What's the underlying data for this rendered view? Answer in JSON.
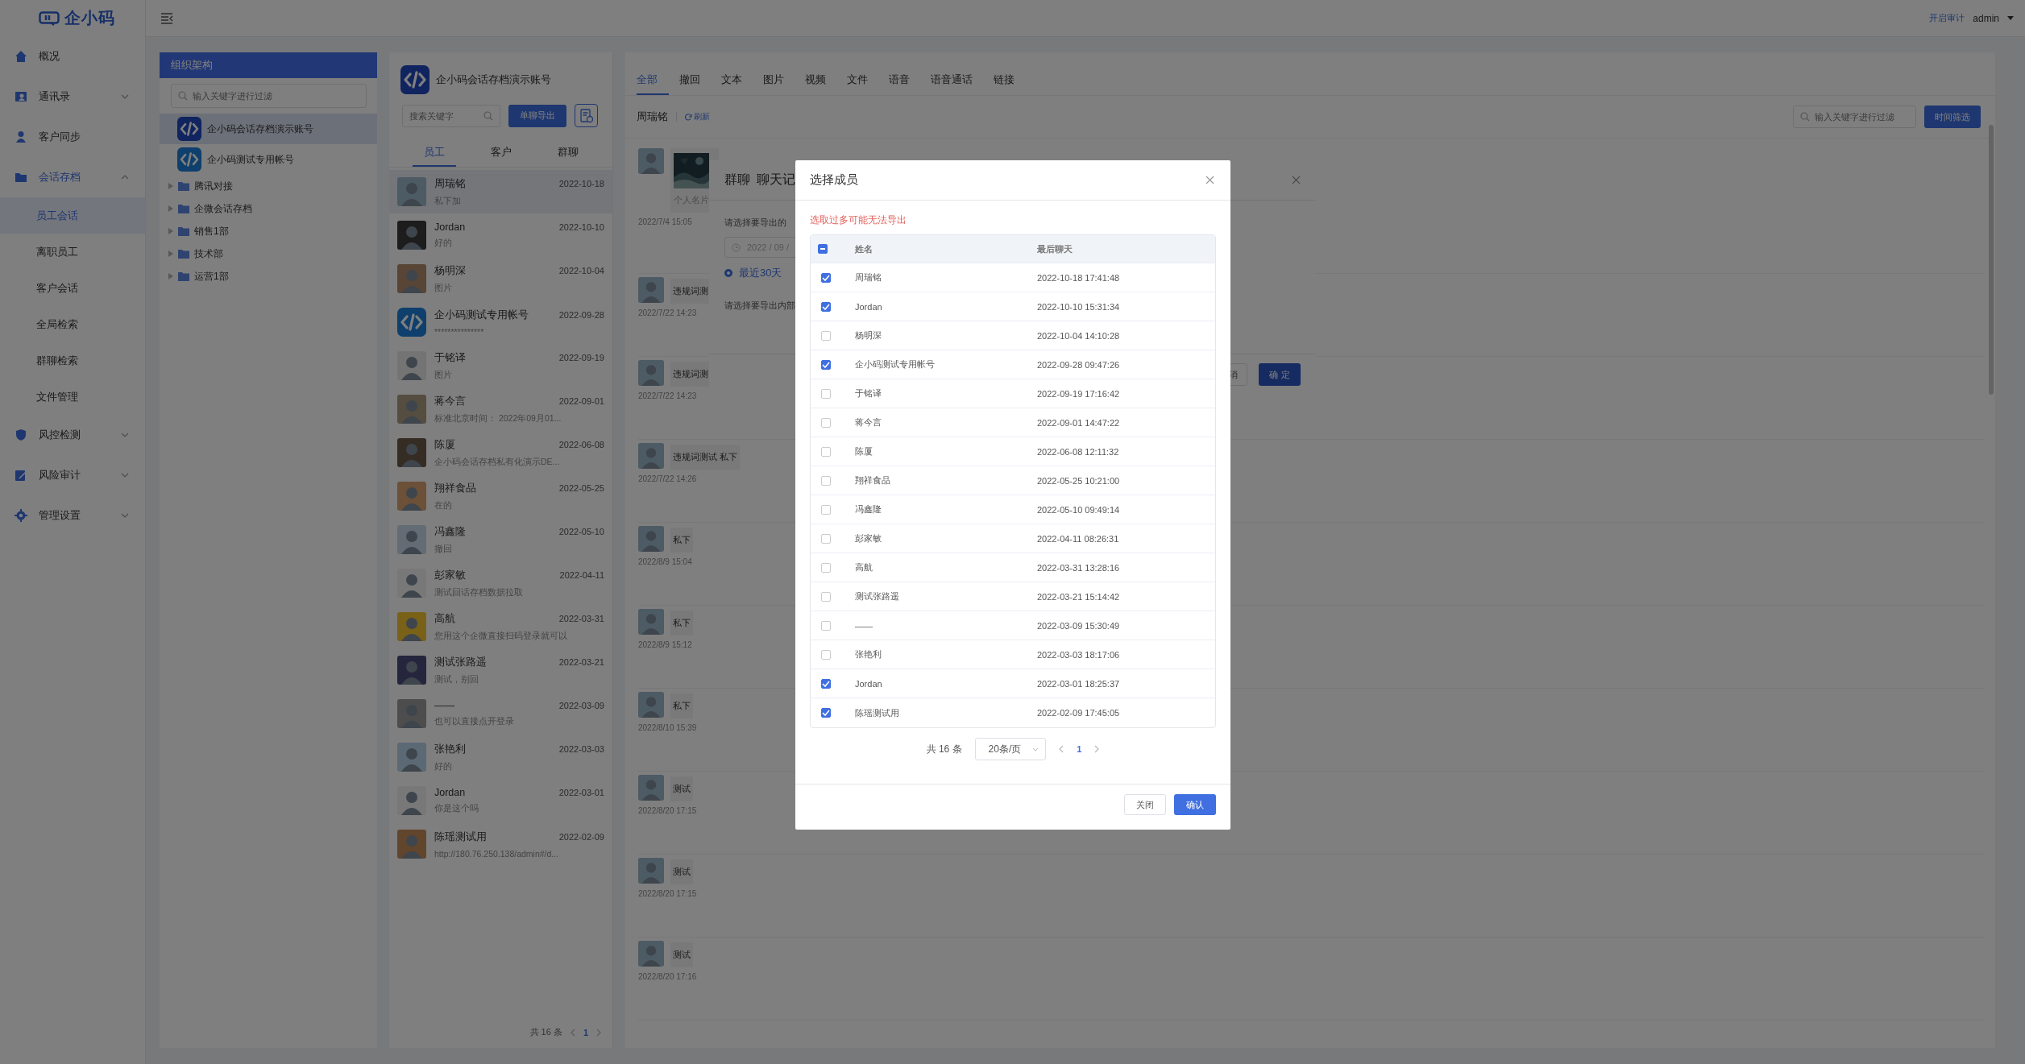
{
  "logo": {
    "text": "企小码"
  },
  "sidebar": {
    "items": [
      {
        "label": "概况",
        "kind": "link",
        "selected": false
      },
      {
        "label": "通讯录",
        "kind": "menu",
        "selected": false,
        "expanded": false
      },
      {
        "label": "客户同步",
        "kind": "link",
        "selected": false
      },
      {
        "label": "会话存档",
        "kind": "menu",
        "selected": true,
        "expanded": true,
        "children": [
          {
            "label": "员工会话",
            "selected": true
          },
          {
            "label": "离职员工",
            "selected": false
          },
          {
            "label": "客户会话",
            "selected": false
          },
          {
            "label": "全局检索",
            "selected": false
          },
          {
            "label": "群聊检索",
            "selected": false
          },
          {
            "label": "文件管理",
            "selected": false
          }
        ]
      },
      {
        "label": "风控检测",
        "kind": "menu",
        "selected": false,
        "expanded": false
      },
      {
        "label": "风险审计",
        "kind": "menu",
        "selected": false,
        "expanded": false
      },
      {
        "label": "管理设置",
        "kind": "menu",
        "selected": false,
        "expanded": false
      }
    ]
  },
  "topbar": {
    "audit_link": "开启审计",
    "user": "admin"
  },
  "org_panel": {
    "title": "组织架构",
    "search": {
      "placeholder": "输入关键字进行过滤"
    },
    "tree": [
      {
        "label": "企小码会话存档演示账号",
        "kind": "account",
        "selected": true
      },
      {
        "label": "企小码测试专用帐号",
        "kind": "account",
        "selected": false
      },
      {
        "label": "腾讯对接",
        "kind": "folder",
        "selected": false,
        "expanded": false
      },
      {
        "label": "企微会话存档",
        "kind": "folder",
        "selected": false,
        "expanded": false
      },
      {
        "label": "销售1部",
        "kind": "folder",
        "selected": false,
        "expanded": false
      },
      {
        "label": "技术部",
        "kind": "folder",
        "selected": false,
        "expanded": false
      },
      {
        "label": "运营1部",
        "kind": "folder",
        "selected": false,
        "expanded": false
      }
    ]
  },
  "conversation_panel": {
    "account": "企小码会话存档演示账号",
    "search": {
      "placeholder": "搜索关键字"
    },
    "export_button": "单聊导出",
    "tabs": [
      {
        "label": "员工",
        "selected": true
      },
      {
        "label": "客户",
        "selected": false
      },
      {
        "label": "群聊",
        "selected": false
      }
    ],
    "conversations": [
      {
        "name": "周瑞铭",
        "date": "2022-10-18",
        "preview": "私下加",
        "kind": "person",
        "selected": true
      },
      {
        "name": "Jordan",
        "date": "2022-10-10",
        "preview": "好的",
        "kind": "person",
        "selected": false
      },
      {
        "name": "杨明深",
        "date": "2022-10-04",
        "preview": "图片",
        "kind": "person",
        "selected": false
      },
      {
        "name": "企小码测试专用帐号",
        "date": "2022-09-28",
        "preview": "***************",
        "kind": "logo",
        "selected": false
      },
      {
        "name": "于铭译",
        "date": "2022-09-19",
        "preview": "图片",
        "kind": "person",
        "selected": false
      },
      {
        "name": "蒋今言",
        "date": "2022-09-01",
        "preview": "标准北京时间： 2022年09月01...",
        "kind": "person",
        "selected": false
      },
      {
        "name": "陈厦",
        "date": "2022-06-08",
        "preview": "企小码会话存档私有化演示DE...",
        "kind": "person",
        "selected": false
      },
      {
        "name": "翔祥食品",
        "date": "2022-05-25",
        "preview": "在的",
        "kind": "person",
        "selected": false
      },
      {
        "name": "冯鑫隆",
        "date": "2022-05-10",
        "preview": "撤回",
        "kind": "person",
        "selected": false
      },
      {
        "name": "彭家敏",
        "date": "2022-04-11",
        "preview": "测试回话存档数据拉取",
        "kind": "person",
        "selected": false
      },
      {
        "name": "高航",
        "date": "2022-03-31",
        "preview": "您用这个企微直接扫码登录就可以",
        "kind": "person",
        "selected": false
      },
      {
        "name": "测试张路遥",
        "date": "2022-03-21",
        "preview": "测试，别回",
        "kind": "person",
        "selected": false
      },
      {
        "name": "——",
        "date": "2022-03-09",
        "preview": "也可以直接点开登录",
        "kind": "person",
        "selected": false
      },
      {
        "name": "张艳利",
        "date": "2022-03-03",
        "preview": "好的",
        "kind": "person",
        "selected": false
      },
      {
        "name": "Jordan",
        "date": "2022-03-01",
        "preview": "你是这个吗",
        "kind": "person",
        "selected": false
      },
      {
        "name": "陈瑶测试用",
        "date": "2022-02-09",
        "preview": "http://180.76.250.138/admin#/d...",
        "kind": "person",
        "selected": false
      }
    ],
    "pagination": {
      "total": "共 16 条",
      "page": "1"
    }
  },
  "chat": {
    "filters": [
      {
        "label": "全部",
        "selected": true
      },
      {
        "label": "撤回",
        "selected": false
      },
      {
        "label": "文本",
        "selected": false
      },
      {
        "label": "图片",
        "selected": false
      },
      {
        "label": "视频",
        "selected": false
      },
      {
        "label": "文件",
        "selected": false
      },
      {
        "label": "语音",
        "selected": false
      },
      {
        "label": "语音通话",
        "selected": false
      },
      {
        "label": "链接",
        "selected": false
      }
    ],
    "contact": "周瑞铭",
    "refresh": "刷新",
    "search": {
      "placeholder": "输入关键字进行过滤"
    },
    "time_filter_button": "时间筛选",
    "messages": [
      {
        "kind": "card",
        "text": "个人名片",
        "time": "2022/7/4 15:05"
      },
      {
        "kind": "text",
        "text": "违规词测",
        "time": "2022/7/22 14:23"
      },
      {
        "kind": "text",
        "text": "违规词测",
        "time": "2022/7/22 14:23"
      },
      {
        "kind": "text",
        "text": "违规词测试 私下",
        "time": "2022/7/22 14:26"
      },
      {
        "kind": "text",
        "text": "私下",
        "time": "2022/8/9 15:04"
      },
      {
        "kind": "text",
        "text": "私下",
        "time": "2022/8/9 15:12"
      },
      {
        "kind": "text",
        "text": "私下",
        "time": "2022/8/10 15:39"
      },
      {
        "kind": "text",
        "text": "测试",
        "time": "2022/8/20 17:15"
      },
      {
        "kind": "text",
        "text": "测试",
        "time": "2022/8/20 17:15"
      },
      {
        "kind": "text",
        "text": "测试",
        "time": "2022/8/20 17:16"
      }
    ]
  },
  "export_dialog": {
    "tag": "群聊",
    "title": "聊天记",
    "date_prompt": "请选择要导出的",
    "date_value": "2022 / 09 /",
    "range_option": {
      "label": "最近30天",
      "selected": true
    },
    "member_prompt": "请选择要导出内部",
    "cancel_button": "消",
    "confirm_button": "确 定"
  },
  "member_dialog": {
    "title": "选择成员",
    "warning": "选取过多可能无法导出",
    "select_all": {
      "indeterminate": true
    },
    "columns": [
      "姓名",
      "最后聊天"
    ],
    "rows": [
      {
        "name": "周瑞铭",
        "last_chat": "2022-10-18 17:41:48",
        "checked": true
      },
      {
        "name": "Jordan",
        "last_chat": "2022-10-10 15:31:34",
        "checked": true
      },
      {
        "name": "杨明深",
        "last_chat": "2022-10-04 14:10:28",
        "checked": false
      },
      {
        "name": "企小码测试专用帐号",
        "last_chat": "2022-09-28 09:47:26",
        "checked": true
      },
      {
        "name": "于铭译",
        "last_chat": "2022-09-19 17:16:42",
        "checked": false
      },
      {
        "name": "蒋今言",
        "last_chat": "2022-09-01 14:47:22",
        "checked": false
      },
      {
        "name": "陈厦",
        "last_chat": "2022-06-08 12:11:32",
        "checked": false
      },
      {
        "name": "翔祥食品",
        "last_chat": "2022-05-25 10:21:00",
        "checked": false
      },
      {
        "name": "冯鑫隆",
        "last_chat": "2022-05-10 09:49:14",
        "checked": false
      },
      {
        "name": "彭家敏",
        "last_chat": "2022-04-11 08:26:31",
        "checked": false
      },
      {
        "name": "高航",
        "last_chat": "2022-03-31 13:28:16",
        "checked": false
      },
      {
        "name": "测试张路遥",
        "last_chat": "2022-03-21 15:14:42",
        "checked": false
      },
      {
        "name": "——",
        "last_chat": "2022-03-09 15:30:49",
        "checked": false
      },
      {
        "name": "张艳利",
        "last_chat": "2022-03-03 18:17:06",
        "checked": false
      },
      {
        "name": "Jordan",
        "last_chat": "2022-03-01 18:25:37",
        "checked": true
      },
      {
        "name": "陈瑶测试用",
        "last_chat": "2022-02-09 17:45:05",
        "checked": true
      }
    ],
    "pagination": {
      "total": "共 16 条",
      "page_size": "20条/页",
      "page": "1"
    },
    "close_button": "关闭",
    "confirm_button": "确认"
  }
}
